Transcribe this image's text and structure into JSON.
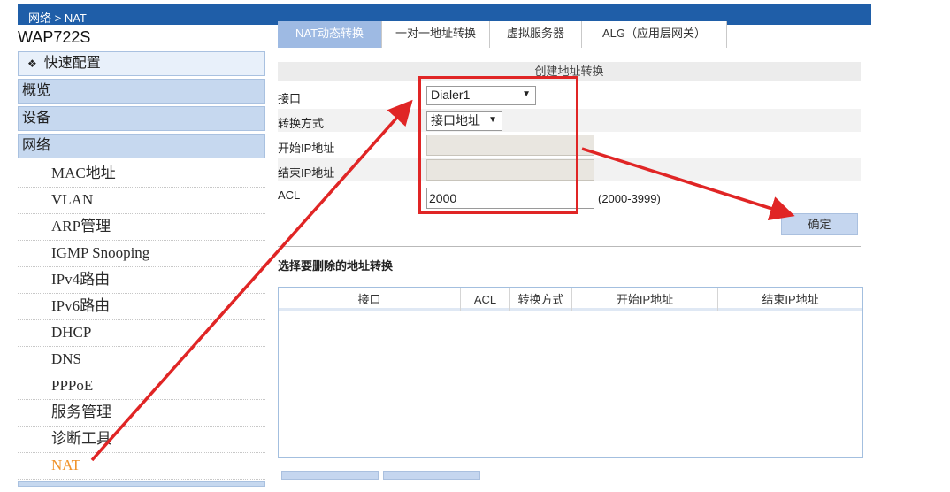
{
  "breadcrumb": "网络 > NAT",
  "device_name": "WAP722S",
  "sidebar": {
    "top_items": [
      {
        "label": "快速配置",
        "icon": "diamond-bullet-icon"
      },
      {
        "label": "概览"
      },
      {
        "label": "设备"
      },
      {
        "label": "网络"
      }
    ],
    "network_subitems": [
      "MAC地址",
      "VLAN",
      "ARP管理",
      "IGMP Snooping",
      "IPv4路由",
      "IPv6路由",
      "DHCP",
      "DNS",
      "PPPoE",
      "服务管理",
      "诊断工具",
      "NAT"
    ],
    "active_subitem": "NAT"
  },
  "tabs": [
    "NAT动态转换",
    "一对一地址转换",
    "虚拟服务器",
    "ALG（应用层网关）"
  ],
  "active_tab": "NAT动态转换",
  "form": {
    "title": "创建地址转换",
    "interface_label": "接口",
    "interface_value": "Dialer1",
    "mode_label": "转换方式",
    "mode_value": "接口地址",
    "start_ip_label": "开始IP地址",
    "start_ip_value": "",
    "end_ip_label": "结束IP地址",
    "end_ip_value": "",
    "acl_label": "ACL",
    "acl_value": "2000",
    "acl_hint": "(2000-3999)",
    "ok_button": "确定"
  },
  "delete_section": {
    "title": "选择要删除的地址转换",
    "columns": [
      "接口",
      "ACL",
      "转换方式",
      "开始IP地址",
      "结束IP地址"
    ],
    "rows": []
  },
  "colors": {
    "topbar": "#1f5ea8",
    "sidebar_item": "#c6d8ef",
    "active_tab": "#9ebae3",
    "active_subitem": "#f0932b",
    "annotation": "#e02525"
  }
}
